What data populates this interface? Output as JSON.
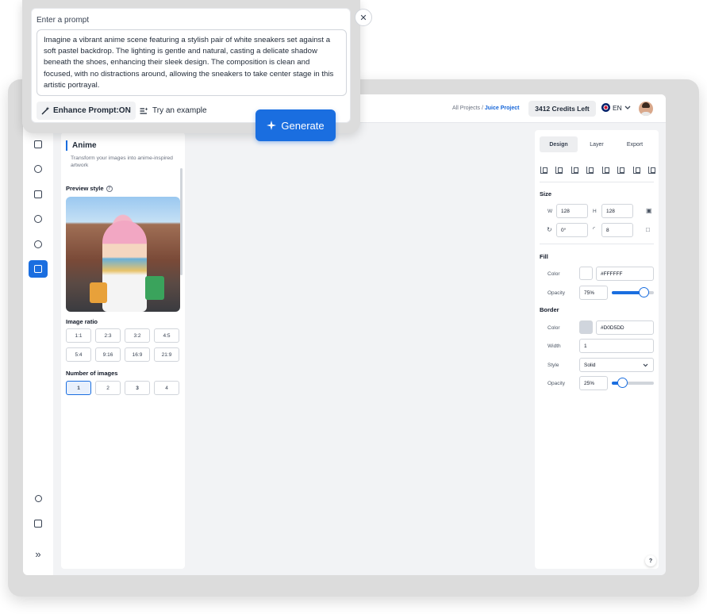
{
  "prompt": {
    "label": "Enter a prompt",
    "text": "Imagine a vibrant anime scene featuring a stylish pair of white sneakers set against a soft pastel backdrop. The lighting is gentle and natural, casting a delicate shadow beneath the shoes, enhancing their sleek design. The composition is clean and focused, with no distractions around, allowing the sneakers to take center stage in this artistic portrayal.",
    "enhance_label": "Enhance Prompt:ON",
    "try_label": "Try an example",
    "close_glyph": "✕",
    "generate_label": "Generate"
  },
  "header": {
    "breadcrumb_root": "All Projects",
    "breadcrumb_sep": "/",
    "breadcrumb_current": "Juice Project",
    "credits": "3412 Credits Left",
    "language": "EN"
  },
  "rail": {
    "icons": [
      "image-icon",
      "settings-icon",
      "image-edit-icon",
      "filter-icon",
      "gear-icon",
      "anime-icon",
      "shapes-icon",
      "gallery-icon",
      "expand-icon"
    ],
    "expand_glyph": "»"
  },
  "style_panel": {
    "title": "Anime",
    "description": "Transform your images into anime-inspired artwork",
    "preview_label": "Preview style",
    "help_glyph": "?",
    "ratio_label": "Image ratio",
    "ratios": [
      "1:1",
      "2:3",
      "3:2",
      "4:5",
      "5:4",
      "9:16",
      "16:9",
      "21:9"
    ],
    "count_label": "Number of images",
    "counts": [
      "1",
      "2",
      "3",
      "4"
    ],
    "selected_count": "1"
  },
  "design_panel": {
    "tabs": [
      "Design",
      "Layer",
      "Export"
    ],
    "active_tab": "Design",
    "size_label": "Size",
    "w_label": "W",
    "w_value": "128",
    "h_label": "H",
    "h_value": "128",
    "rotation_value": "0°",
    "radius_value": "8",
    "fill_label": "Fill",
    "fill_color_label": "Color",
    "fill_color": "#FFFFFF",
    "fill_opacity_label": "Opacity",
    "fill_opacity": "75%",
    "fill_opacity_fraction": 0.75,
    "border_label": "Border",
    "border_color_label": "Color",
    "border_color": "#D0D5DD",
    "border_width_label": "Width",
    "border_width": "1",
    "border_style_label": "Style",
    "border_style": "Solid",
    "border_opacity_label": "Opacity",
    "border_opacity": "25%",
    "border_opacity_fraction": 0.25,
    "help_glyph": "?"
  },
  "colors": {
    "accent": "#1A6EE0",
    "fill_swatch": "#FFFFFF",
    "border_swatch": "#D0D5DD"
  }
}
